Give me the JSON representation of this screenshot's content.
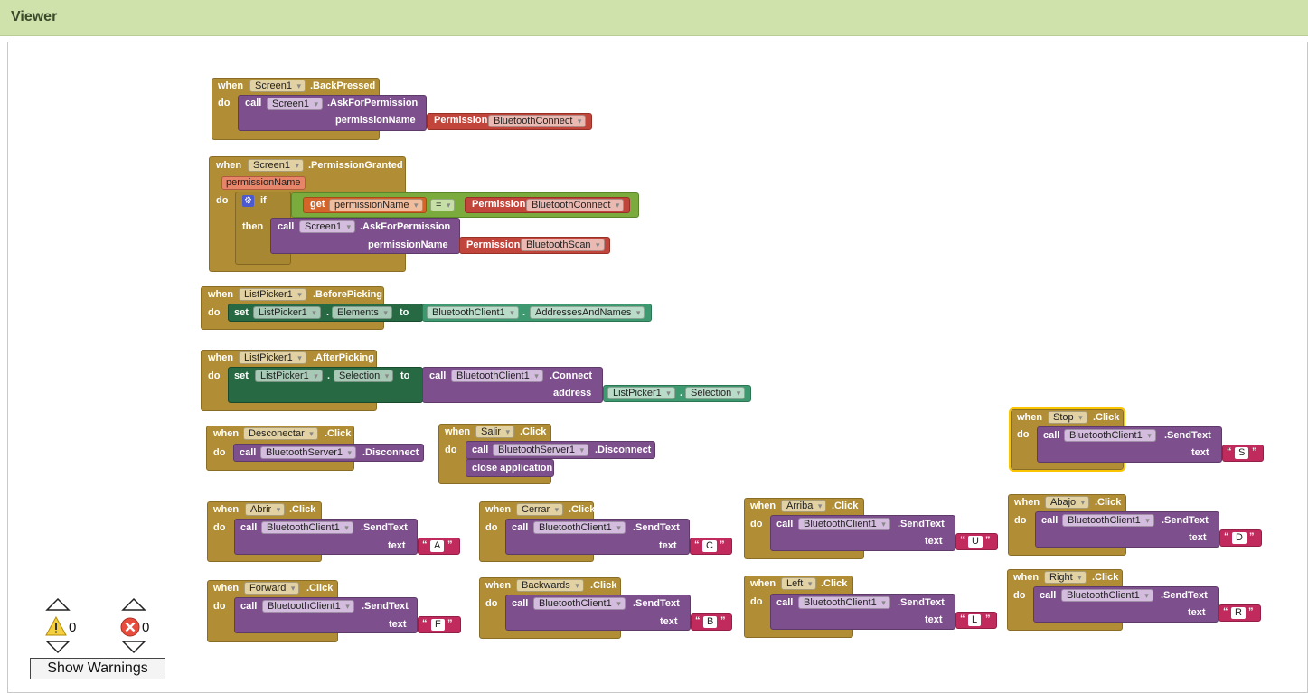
{
  "viewer": {
    "title": "Viewer"
  },
  "kw": {
    "when": "when",
    "do": "do",
    "call": "call",
    "set": "set",
    "to": "to",
    "if": "if",
    "then": "then",
    "get": "get",
    "text": "text",
    "address": "address",
    "dot": "."
  },
  "blocks": {
    "back": {
      "comp": "Screen1",
      "event": ".BackPressed",
      "call_comp": "Screen1",
      "method": ".AskForPermission",
      "arg": "permissionName",
      "perm_label": "Permission",
      "perm": "BluetoothConnect"
    },
    "granted": {
      "comp": "Screen1",
      "event": ".PermissionGranted",
      "param": "permissionName",
      "get_var": "permissionName",
      "op": "=",
      "perm_label": "Permission",
      "perm": "BluetoothConnect",
      "call_comp": "Screen1",
      "method": ".AskForPermission",
      "arg": "permissionName",
      "perm2_label": "Permission",
      "perm2": "BluetoothScan"
    },
    "before": {
      "comp": "ListPicker1",
      "event": ".BeforePicking",
      "set_comp": "ListPicker1",
      "set_prop": "Elements",
      "get_comp": "BluetoothClient1",
      "get_prop": "AddressesAndNames"
    },
    "after": {
      "comp": "ListPicker1",
      "event": ".AfterPicking",
      "set_comp": "ListPicker1",
      "set_prop": "Selection",
      "call_comp": "BluetoothClient1",
      "method": ".Connect",
      "arg": "address",
      "get_comp": "ListPicker1",
      "get_prop": "Selection"
    },
    "desconectar": {
      "comp": "Desconectar",
      "event": ".Click",
      "call_comp": "BluetoothServer1",
      "method": ".Disconnect"
    },
    "salir": {
      "comp": "Salir",
      "event": ".Click",
      "call_comp": "BluetoothServer1",
      "method": ".Disconnect",
      "close": "close application"
    },
    "stop": {
      "comp": "Stop",
      "event": ".Click",
      "call_comp": "BluetoothClient1",
      "method": ".SendText",
      "value": "S"
    },
    "abrir": {
      "comp": "Abrir",
      "event": ".Click",
      "call_comp": "BluetoothClient1",
      "method": ".SendText",
      "value": "A"
    },
    "cerrar": {
      "comp": "Cerrar",
      "event": ".Click",
      "call_comp": "BluetoothClient1",
      "method": ".SendText",
      "value": "C"
    },
    "arriba": {
      "comp": "Arriba",
      "event": ".Click",
      "call_comp": "BluetoothClient1",
      "method": ".SendText",
      "value": "U"
    },
    "abajo": {
      "comp": "Abajo",
      "event": ".Click",
      "call_comp": "BluetoothClient1",
      "method": ".SendText",
      "value": "D"
    },
    "forward": {
      "comp": "Forward",
      "event": ".Click",
      "call_comp": "BluetoothClient1",
      "method": ".SendText",
      "value": "F"
    },
    "backwards": {
      "comp": "Backwards",
      "event": ".Click",
      "call_comp": "BluetoothClient1",
      "method": ".SendText",
      "value": "B"
    },
    "left": {
      "comp": "Left",
      "event": ".Click",
      "call_comp": "BluetoothClient1",
      "method": ".SendText",
      "value": "L"
    },
    "right": {
      "comp": "Right",
      "event": ".Click",
      "call_comp": "BluetoothClient1",
      "method": ".SendText",
      "value": "R"
    }
  },
  "warnings": {
    "warning_count": "0",
    "error_count": "0",
    "show_label": "Show Warnings"
  },
  "colors": {
    "event": "#b18e35",
    "procedure": "#7d4f8c",
    "setter": "#266942",
    "getter": "#3f9970",
    "permission": "#c1453a",
    "variable": "#d4652a",
    "logic": "#7aab3c",
    "text": "#c02a5d",
    "header": "#cfe2ac"
  }
}
